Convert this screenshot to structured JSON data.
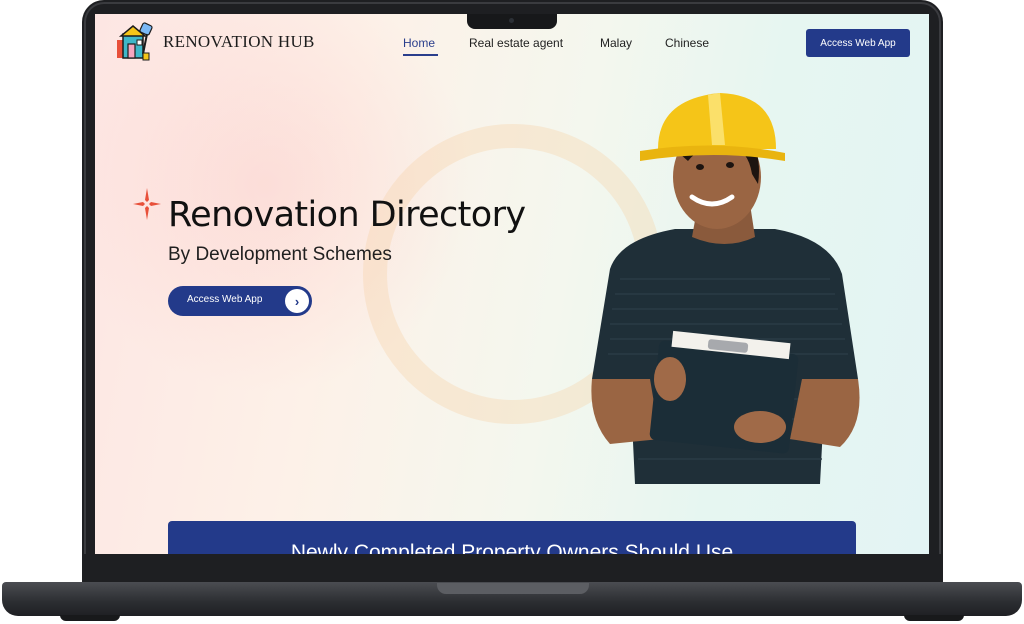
{
  "brand": {
    "name": "RENOVATION HUB"
  },
  "nav": {
    "items": [
      {
        "label": "Home",
        "active": true
      },
      {
        "label": "Real estate agent",
        "active": false
      },
      {
        "label": "Malay",
        "active": false
      },
      {
        "label": "Chinese",
        "active": false
      }
    ],
    "cta_label": "Access Web App"
  },
  "hero": {
    "title": "Renovation Directory",
    "subtitle": "By Development Schemes",
    "cta_label": "Access Web App",
    "cta_arrow": "›"
  },
  "banner": {
    "text": "Newly Completed Property Owners Should Use"
  },
  "colors": {
    "accent": "#233a8a",
    "sparkle": "#e8503a",
    "helmet": "#f5c518",
    "shirt": "#1f2f38"
  },
  "icons": [
    "renovation-hub-logo-icon",
    "sparkle-icon",
    "chevron-right-icon"
  ]
}
